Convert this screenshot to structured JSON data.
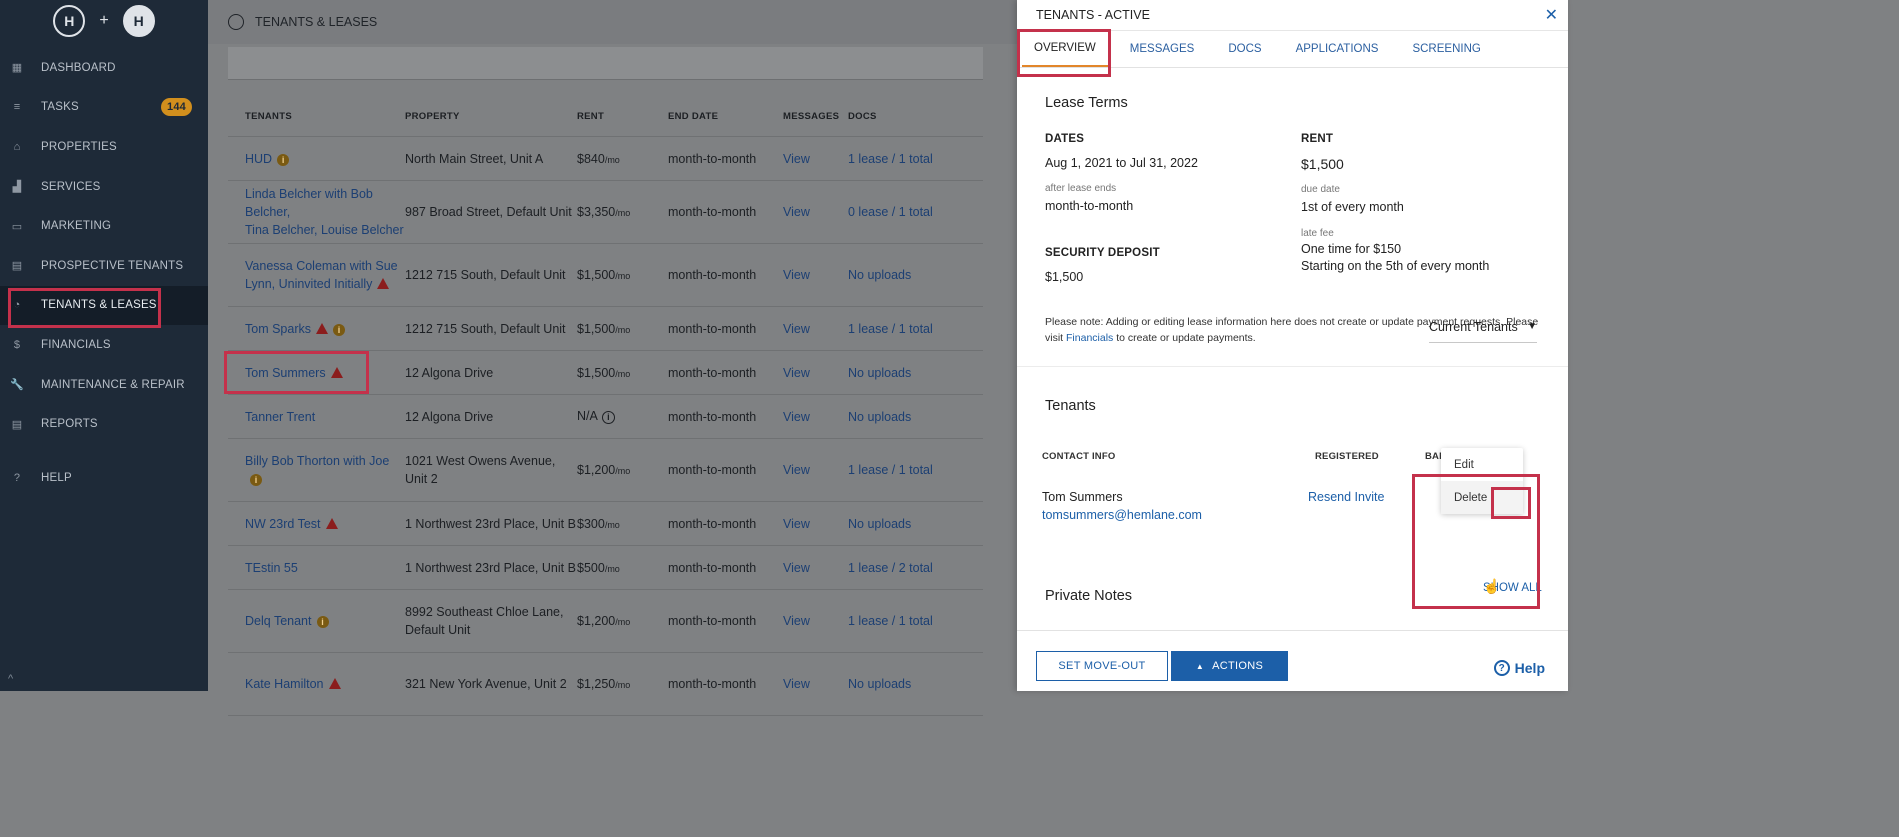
{
  "sidebar": {
    "badge_count": "144",
    "items": [
      {
        "label": "DASHBOARD",
        "icon": "dashboard-icon",
        "glyph": "▦"
      },
      {
        "label": "TASKS",
        "icon": "tasks-icon",
        "glyph": "≡"
      },
      {
        "label": "PROPERTIES",
        "icon": "home-icon",
        "glyph": "⌂"
      },
      {
        "label": "SERVICES",
        "icon": "services-icon",
        "glyph": "▟"
      },
      {
        "label": "MARKETING",
        "icon": "marketing-icon",
        "glyph": "▭"
      },
      {
        "label": "PROSPECTIVE TENANTS",
        "icon": "clipboard-icon",
        "glyph": "▤"
      },
      {
        "label": "TENANTS & LEASES",
        "icon": "tenants-icon",
        "glyph": "◔"
      },
      {
        "label": "FINANCIALS",
        "icon": "dollar-icon",
        "glyph": "$"
      },
      {
        "label": "MAINTENANCE & REPAIR",
        "icon": "wrench-icon",
        "glyph": "🔧"
      },
      {
        "label": "REPORTS",
        "icon": "document-icon",
        "glyph": "▤"
      },
      {
        "label": "HELP",
        "icon": "help-icon",
        "glyph": "?"
      }
    ]
  },
  "topbar": {
    "title": "TENANTS & LEASES"
  },
  "table": {
    "headers": [
      "TENANTS",
      "PROPERTY",
      "RENT",
      "END DATE",
      "MESSAGES",
      "DOCS"
    ],
    "per_month": "/mo",
    "rows": [
      {
        "tenant": "HUD",
        "tenant2": "",
        "flags": [
          "info"
        ],
        "property": "North Main Street, Unit A",
        "property2": "",
        "rent": "$840",
        "per": "/mo",
        "end": "month-to-month",
        "messages": "View",
        "docs": "1 lease / 1 total"
      },
      {
        "tenant": "Linda Belcher with Bob Belcher,",
        "tenant2": "Tina Belcher, Louise Belcher",
        "flags": [],
        "property": "987 Broad Street, Default Unit",
        "property2": "",
        "rent": "$3,350",
        "per": "/mo",
        "end": "month-to-month",
        "messages": "View",
        "docs": "0 lease / 1 total"
      },
      {
        "tenant": "Vanessa Coleman with Sue",
        "tenant2": "Lynn, Uninvited Initially",
        "flags": [
          "warn2"
        ],
        "property": "1212 715 South, Default Unit",
        "property2": "",
        "rent": "$1,500",
        "per": "/mo",
        "end": "month-to-month",
        "messages": "View",
        "docs": "No uploads"
      },
      {
        "tenant": "Tom Sparks",
        "tenant2": "",
        "flags": [
          "warn",
          "info"
        ],
        "property": "1212 715 South, Default Unit",
        "property2": "",
        "rent": "$1,500",
        "per": "/mo",
        "end": "month-to-month",
        "messages": "View",
        "docs": "1 lease / 1 total"
      },
      {
        "tenant": "Tom Summers",
        "tenant2": "",
        "flags": [
          "warn"
        ],
        "property": "12 Algona Drive",
        "property2": "",
        "rent": "$1,500",
        "per": "/mo",
        "end": "month-to-month",
        "messages": "View",
        "docs": "No uploads"
      },
      {
        "tenant": "Tanner Trent",
        "tenant2": "",
        "flags": [],
        "property": "12 Algona Drive",
        "property2": "",
        "rent": "N/A",
        "per": "",
        "end": "month-to-month",
        "messages": "View",
        "docs": "No uploads"
      },
      {
        "tenant": "Billy Bob Thorton with Joe",
        "tenant2": "",
        "flags": [
          "info"
        ],
        "property": "1021 West Owens Avenue,",
        "property2": "Unit 2",
        "rent": "$1,200",
        "per": "/mo",
        "end": "month-to-month",
        "messages": "View",
        "docs": "1 lease / 1 total"
      },
      {
        "tenant": "NW 23rd Test",
        "tenant2": "",
        "flags": [
          "warn"
        ],
        "property": "1 Northwest 23rd Place, Unit B",
        "property2": "",
        "rent": "$300",
        "per": "/mo",
        "end": "month-to-month",
        "messages": "View",
        "docs": "No uploads"
      },
      {
        "tenant": "TEstin 55",
        "tenant2": "",
        "flags": [],
        "property": "1 Northwest 23rd Place, Unit B",
        "property2": "",
        "rent": "$500",
        "per": "/mo",
        "end": "month-to-month",
        "messages": "View",
        "docs": "1 lease / 2 total"
      },
      {
        "tenant": "Delq Tenant",
        "tenant2": "",
        "flags": [
          "info"
        ],
        "property": "8992 Southeast Chloe Lane,",
        "property2": "Default Unit",
        "rent": "$1,200",
        "per": "/mo",
        "end": "month-to-month",
        "messages": "View",
        "docs": "1 lease / 1 total"
      },
      {
        "tenant": "Kate Hamilton",
        "tenant2": "",
        "flags": [
          "warn"
        ],
        "property": "321 New York Avenue, Unit 2",
        "property2": "",
        "rent": "$1,250",
        "per": "/mo",
        "end": "month-to-month",
        "messages": "View",
        "docs": "No uploads"
      }
    ]
  },
  "drawer": {
    "title": "TENANTS - ACTIVE",
    "tabs": [
      "OVERVIEW",
      "MESSAGES",
      "DOCS",
      "APPLICATIONS",
      "SCREENING"
    ],
    "lease_terms": {
      "heading": "Lease Terms",
      "dates_label": "DATES",
      "dates_value": "Aug 1, 2021 to Jul 31, 2022",
      "after_label": "after lease ends",
      "after_value": "month-to-month",
      "rent_label": "RENT",
      "rent_value": "$1,500",
      "due_label": "due date",
      "due_value": "1st of every month",
      "late_label": "late fee",
      "late_value1": "One time for $150",
      "late_value2": "Starting on the 5th of every month",
      "deposit_label": "SECURITY DEPOSIT",
      "deposit_value": "$1,500",
      "note_part1": "Please note: Adding or editing lease information here does not create or update payment requests. Please visit",
      "note_link": "Financials",
      "note_part2": "to create or update payments."
    },
    "tenants": {
      "heading": "Tenants",
      "filter": "Current Tenants",
      "col_contact": "CONTACT INFO",
      "col_registered": "REGISTERED",
      "col_bank": "BANK SET UP",
      "name": "Tom Summers",
      "email": "tomsummers@hemlane.com",
      "resend": "Resend Invite",
      "bank_value": "-",
      "menu_edit": "Edit",
      "menu_delete": "Delete"
    },
    "notes": {
      "heading": "Private Notes",
      "show_all": "SHOW ALL"
    },
    "footer": {
      "move_out": "SET MOVE-OUT",
      "actions": "ACTIONS",
      "help": "Help"
    }
  }
}
